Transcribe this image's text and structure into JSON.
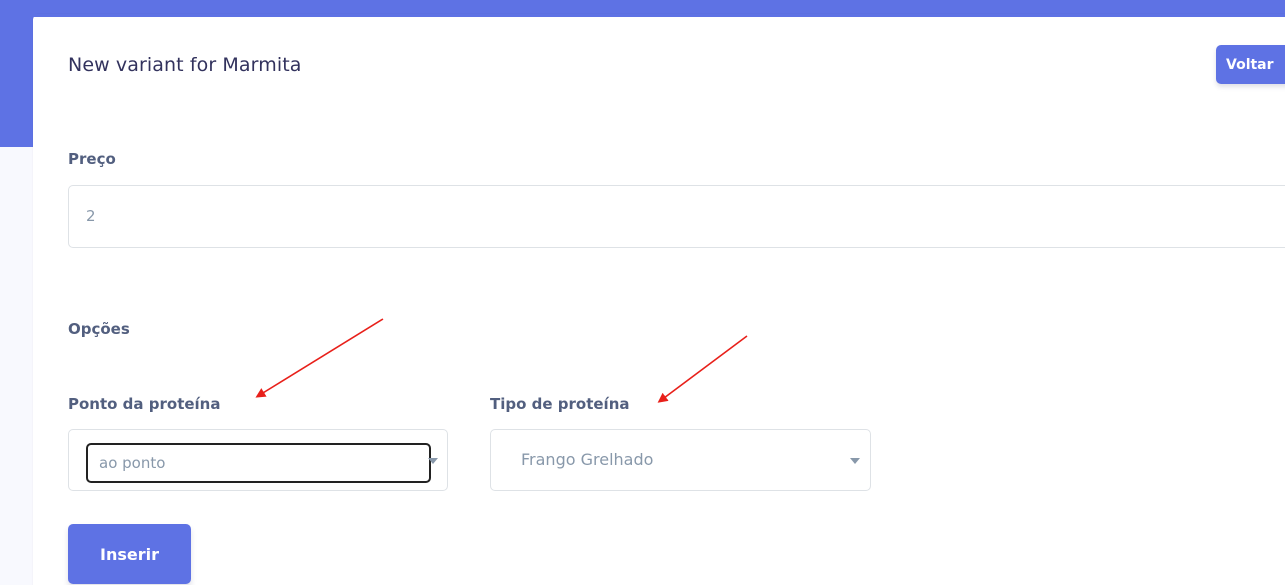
{
  "card": {
    "title": "New variant for Marmita",
    "back_label": "Voltar"
  },
  "price": {
    "label": "Preço",
    "value": "2"
  },
  "options": {
    "heading": "Opções",
    "fields": [
      {
        "label": "Ponto da proteína",
        "selected": "ao ponto"
      },
      {
        "label": "Tipo de proteína",
        "selected": "Frango Grelhado"
      }
    ]
  },
  "submit": {
    "label": "Inserir"
  },
  "colors": {
    "accent": "#5e72e4",
    "annotation_arrow": "#e8201a"
  },
  "icons": {
    "select_caret": "caret-down-icon",
    "annotation": "red-arrow-icon"
  }
}
